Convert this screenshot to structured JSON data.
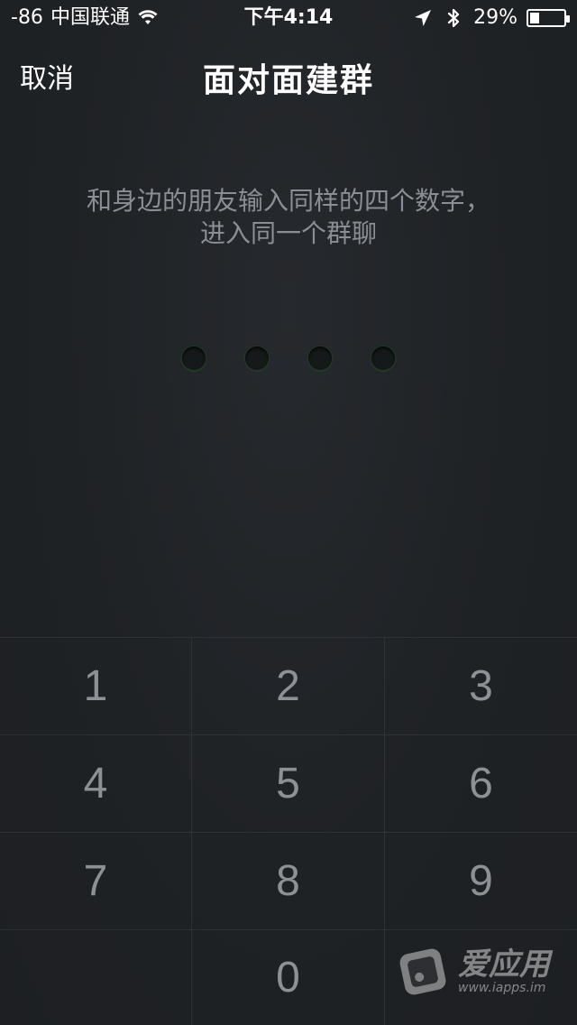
{
  "status_bar": {
    "signal": "-86",
    "carrier": "中国联通",
    "time": "下午4:14",
    "battery_percent": "29%",
    "battery_level": 0.29,
    "icons": [
      "wifi-icon",
      "location-arrow-icon",
      "bluetooth-icon",
      "battery-icon"
    ]
  },
  "nav": {
    "cancel_label": "取消",
    "title": "面对面建群"
  },
  "instructions": {
    "line1": "和身边的朋友输入同样的四个数字，",
    "line2": "进入同一个群聊"
  },
  "code": {
    "entered": 0,
    "length": 4
  },
  "keypad": {
    "keys": [
      "1",
      "2",
      "3",
      "4",
      "5",
      "6",
      "7",
      "8",
      "9",
      "",
      "0",
      ""
    ]
  },
  "watermark": {
    "title": "爱应用",
    "url": "www.iapps.im"
  },
  "colors": {
    "background": "#1f2124",
    "accent_green": "#2f8a3c",
    "key_text": "#8d9095",
    "instruction_text": "#8b8f95"
  }
}
